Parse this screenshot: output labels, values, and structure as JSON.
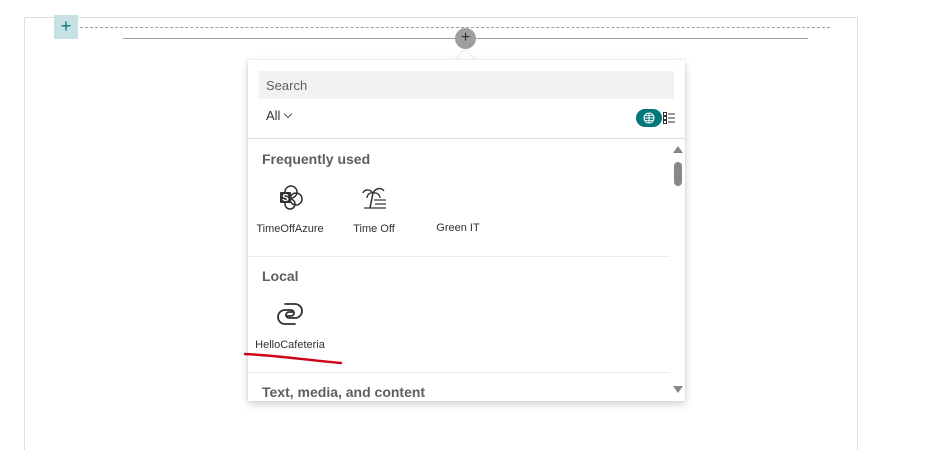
{
  "canvas": {
    "section_add_icon": "plus-icon",
    "webpart_add_icon": "plus-icon"
  },
  "toolbox": {
    "search": {
      "placeholder": "Search",
      "value": ""
    },
    "filter": {
      "label": "All",
      "icon": "chevron-down-icon"
    },
    "view_toggle": {
      "selected": "grid",
      "icons": [
        "grid-view-icon",
        "list-view-icon"
      ]
    },
    "groups": [
      {
        "title": "Frequently used",
        "items": [
          {
            "label": "TimeOffAzure",
            "icon": "sharepoint-icon"
          },
          {
            "label": "Time Off",
            "icon": "beach-palm-icon"
          },
          {
            "label": "Green IT",
            "icon": ""
          }
        ]
      },
      {
        "title": "Local",
        "items": [
          {
            "label": "HelloCafeteria",
            "icon": "power-apps-icon"
          }
        ]
      },
      {
        "title": "Text, media, and content",
        "items": []
      }
    ]
  },
  "annotation": {
    "underline_color": "#d0021b"
  },
  "colors": {
    "accent": "#03787c",
    "accent_light": "#c7e0e3"
  }
}
